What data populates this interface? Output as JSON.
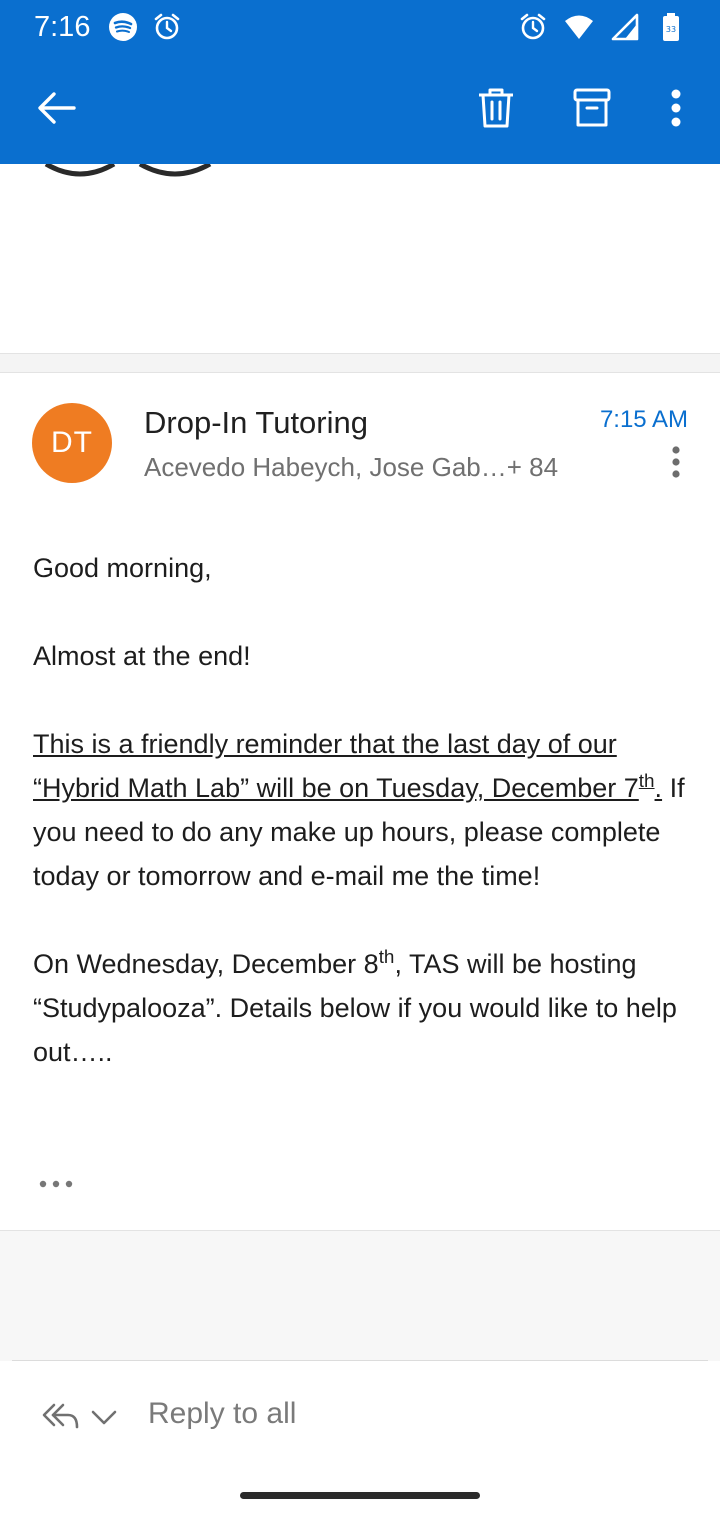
{
  "status_bar": {
    "time": "7:16",
    "left_icons": [
      "spotify-icon",
      "alarm-icon"
    ],
    "right_icons": [
      "alarm-icon",
      "wifi-icon",
      "signal-icon",
      "battery-icon"
    ],
    "battery_level": "33"
  },
  "toolbar": {
    "back_icon": "back-arrow-icon",
    "actions": [
      "delete-icon",
      "archive-icon",
      "more-vert-icon"
    ]
  },
  "message": {
    "avatar_initials": "DT",
    "avatar_color": "#ef7c22",
    "sender": "Drop-In Tutoring",
    "recipients": "Acevedo Habeych, Jose Gab…+ 84",
    "time": "7:15 AM",
    "body": {
      "p1": "Good morning,",
      "p2": "Almost at the end!",
      "p3_u1": "This is a friendly reminder that the last day of our “Hybrid Math Lab” will be on Tuesday, December 7",
      "p3_sup": "th",
      "p3_u2": ".",
      "p3_rest": " If you need to do any make up hours, please complete today or tomorrow and e-mail me the time!",
      "p4_a": "On Wednesday, December 8",
      "p4_sup": "th",
      "p4_b": ", TAS will be hosting “Studypalooza”. Details below if you would like to help out…..",
      "expand_label": "•••"
    }
  },
  "reply": {
    "label": "Reply to all",
    "icon": "reply-all-icon",
    "chevron": "chevron-down-icon"
  },
  "colors": {
    "header_blue": "#0a6fcf",
    "time_blue": "#0a6fcf"
  }
}
